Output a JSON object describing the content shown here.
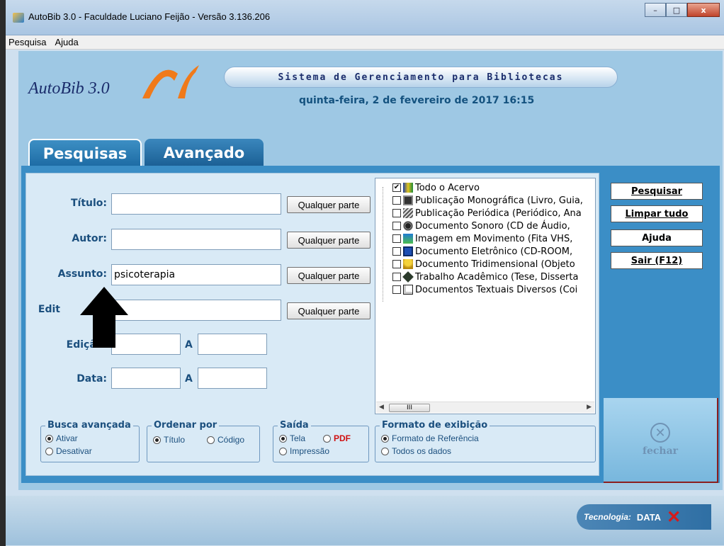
{
  "window": {
    "title": "AutoBib 3.0 - Faculdade Luciano Feijão - Versão 3.136.206",
    "minimize": "–",
    "maximize": "□",
    "close": "x"
  },
  "menu": {
    "items": [
      "Pesquisa",
      "Ajuda"
    ]
  },
  "header": {
    "logo_text": "AutoBib 3.0",
    "system_title": "Sistema de Gerenciamento para Bibliotecas",
    "datetime": "quinta-feira, 2 de fevereiro de 2017 16:15"
  },
  "tabs": [
    {
      "label": "Pesquisas",
      "active": true
    },
    {
      "label": "Avançado",
      "active": false
    }
  ],
  "form": {
    "titulo": {
      "label": "Título:",
      "value": "",
      "mode": "Qualquer parte"
    },
    "autor": {
      "label": "Autor:",
      "value": "",
      "mode": "Qualquer parte"
    },
    "assunto": {
      "label": "Assunto:",
      "value": "psicoterapia",
      "mode": "Qualquer parte"
    },
    "editora": {
      "label": "Edit",
      "value": "",
      "mode": "Qualquer parte"
    },
    "edicao": {
      "label": "Edição:",
      "from": "",
      "sep": "A",
      "to": ""
    },
    "data": {
      "label": "Data:",
      "from": "",
      "sep": "A",
      "to": ""
    }
  },
  "tree": {
    "items": [
      {
        "label": "Todo o Acervo",
        "checked": true,
        "icon": "library-icon"
      },
      {
        "label": "Publicação Monográfica (Livro, Guia,",
        "checked": false,
        "icon": "book-icon"
      },
      {
        "label": "Publicação Periódica (Periódico, Ana",
        "checked": false,
        "icon": "periodical-icon"
      },
      {
        "label": "Documento Sonoro (CD de Áudio,",
        "checked": false,
        "icon": "audio-icon"
      },
      {
        "label": "Imagem em Movimento (Fita VHS,",
        "checked": false,
        "icon": "film-icon"
      },
      {
        "label": "Documento Eletrônico (CD-ROOM,",
        "checked": false,
        "icon": "floppy-icon"
      },
      {
        "label": "Documento Tridimensional (Objeto",
        "checked": false,
        "icon": "trophy-icon"
      },
      {
        "label": "Trabalho Acadêmico (Tese, Disserta",
        "checked": false,
        "icon": "academic-icon"
      },
      {
        "label": "Documentos Textuais Diversos (Coi",
        "checked": false,
        "icon": "text-document-icon"
      }
    ],
    "scroll_thumb": "III"
  },
  "busca_avancada": {
    "title": "Busca avançada",
    "options": [
      "Ativar",
      "Desativar"
    ],
    "selected": "Ativar"
  },
  "ordenar_por": {
    "title": "Ordenar por",
    "options": [
      "Título",
      "Código"
    ],
    "selected": "Título"
  },
  "saida": {
    "title": "Saída",
    "options": [
      "Tela",
      "PDF",
      "Impressão"
    ],
    "selected": "Tela"
  },
  "formato": {
    "title": "Formato de exibição",
    "options": [
      "Formato de Referência",
      "Todos os dados"
    ],
    "selected": "Formato de Referência"
  },
  "actions": {
    "pesquisar": "Pesquisar",
    "limpar": "Limpar tudo",
    "ajuda": "Ajuda",
    "sair": "Sair (F12)"
  },
  "fechar": {
    "label": "fechar",
    "icon": "close-circle-icon"
  },
  "footer": {
    "tech_label": "Tecnologia:",
    "tech_logo": "DATA"
  }
}
